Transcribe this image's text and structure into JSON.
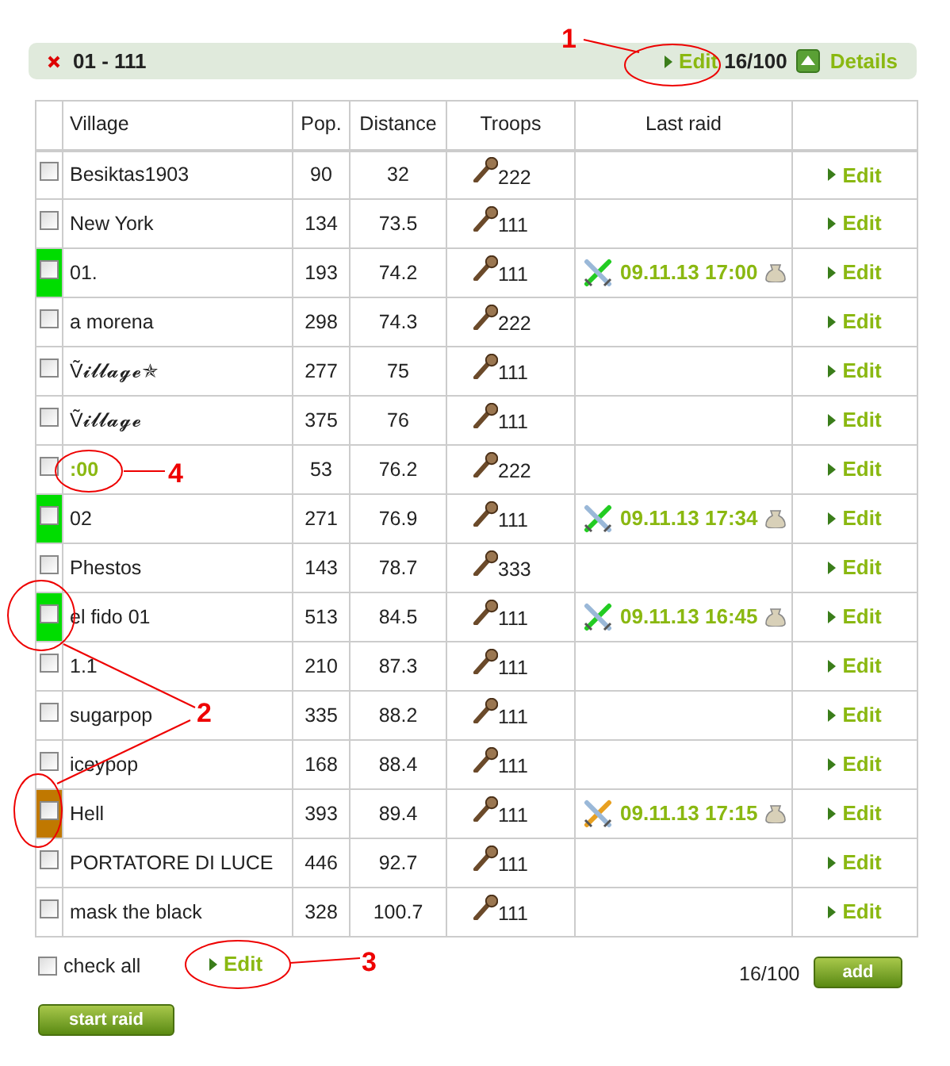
{
  "list_header": {
    "title": "01 - 111",
    "edit_link": "Edit",
    "count": "16/100",
    "details_link": "Details"
  },
  "table": {
    "columns": [
      "Village",
      "Pop.",
      "Distance",
      "Troops",
      "Last raid"
    ],
    "rows": [
      {
        "village": "Besiktas1903",
        "village_link": false,
        "pop": "90",
        "distance": "32",
        "troops": "222",
        "edit": "Edit",
        "checked": false
      },
      {
        "village": "New York",
        "village_link": false,
        "pop": "134",
        "distance": "73.5",
        "troops": "111",
        "edit": "Edit",
        "checked": false
      },
      {
        "village": "01.",
        "village_link": false,
        "color": "#00dd00",
        "pop": "193",
        "distance": "74.2",
        "troops": "111",
        "last_raid": {
          "kind": "won",
          "time": "09.11.13 17:00"
        },
        "edit": "Edit",
        "checked": false
      },
      {
        "village": "a morena",
        "village_link": false,
        "pop": "298",
        "distance": "74.3",
        "troops": "222",
        "edit": "Edit",
        "checked": false
      },
      {
        "village": "Ṽ𝓲𝓵𝓵𝓪𝓰𝓮✯",
        "village_link": false,
        "pop": "277",
        "distance": "75",
        "troops": "111",
        "edit": "Edit",
        "checked": false
      },
      {
        "village": "Ṽ𝓲𝓵𝓵𝓪𝓰𝓮",
        "village_link": false,
        "pop": "375",
        "distance": "76",
        "troops": "111",
        "edit": "Edit",
        "checked": false
      },
      {
        "village": ":00",
        "village_link": true,
        "pop": "53",
        "distance": "76.2",
        "troops": "222",
        "edit": "Edit",
        "checked": false
      },
      {
        "village": "02",
        "village_link": false,
        "color": "#00dd00",
        "pop": "271",
        "distance": "76.9",
        "troops": "111",
        "last_raid": {
          "kind": "won",
          "time": "09.11.13 17:34"
        },
        "edit": "Edit",
        "checked": false
      },
      {
        "village": "Phestos",
        "village_link": false,
        "pop": "143",
        "distance": "78.7",
        "troops": "333",
        "edit": "Edit",
        "checked": false
      },
      {
        "village": "el fido 01",
        "village_link": false,
        "color": "#00dd00",
        "pop": "513",
        "distance": "84.5",
        "troops": "111",
        "last_raid": {
          "kind": "won",
          "time": "09.11.13 16:45"
        },
        "edit": "Edit",
        "checked": false
      },
      {
        "village": "1.1",
        "village_link": false,
        "pop": "210",
        "distance": "87.3",
        "troops": "111",
        "edit": "Edit",
        "checked": false
      },
      {
        "village": "sugarpop",
        "village_link": false,
        "pop": "335",
        "distance": "88.2",
        "troops": "111",
        "edit": "Edit",
        "checked": false
      },
      {
        "village": "iceypop",
        "village_link": false,
        "pop": "168",
        "distance": "88.4",
        "troops": "111",
        "edit": "Edit",
        "checked": false
      },
      {
        "village": "Hell",
        "village_link": false,
        "color": "#c07800",
        "pop": "393",
        "distance": "89.4",
        "troops": "111",
        "last_raid": {
          "kind": "losses",
          "time": "09.11.13 17:15"
        },
        "edit": "Edit",
        "checked": false
      },
      {
        "village": "PORTATORE DI LUCE",
        "village_link": false,
        "pop": "446",
        "distance": "92.7",
        "troops": "111",
        "edit": "Edit",
        "checked": false
      },
      {
        "village": "mask the black",
        "village_link": false,
        "pop": "328",
        "distance": "100.7",
        "troops": "111",
        "edit": "Edit",
        "checked": false
      }
    ]
  },
  "footer": {
    "check_all": {
      "label": "check all",
      "checked": false
    },
    "edit_link": "Edit",
    "count": "16/100",
    "add_button": "add",
    "start_button": "start raid"
  },
  "annotations": [
    {
      "label": "1"
    },
    {
      "label": "2"
    },
    {
      "label": "3"
    },
    {
      "label": "4"
    }
  ]
}
